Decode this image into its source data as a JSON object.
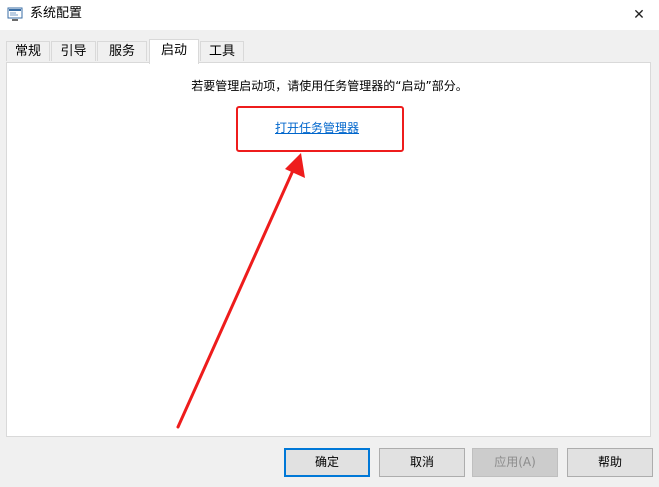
{
  "window": {
    "title": "系统配置",
    "close_glyph": "✕"
  },
  "tabs": [
    {
      "label": "常规",
      "active": false
    },
    {
      "label": "引导",
      "active": false
    },
    {
      "label": "服务",
      "active": false
    },
    {
      "label": "启动",
      "active": true
    },
    {
      "label": "工具",
      "active": false
    }
  ],
  "startup": {
    "info": "若要管理启动项，请使用任务管理器的“启动”部分。",
    "link": "打开任务管理器"
  },
  "buttons": {
    "ok": "确定",
    "cancel": "取消",
    "apply": "应用(A)",
    "help": "帮助"
  },
  "annotation": {
    "color": "#ee1c1c"
  },
  "icons": {
    "app": "msconfig-window-icon",
    "close": "close-icon"
  }
}
